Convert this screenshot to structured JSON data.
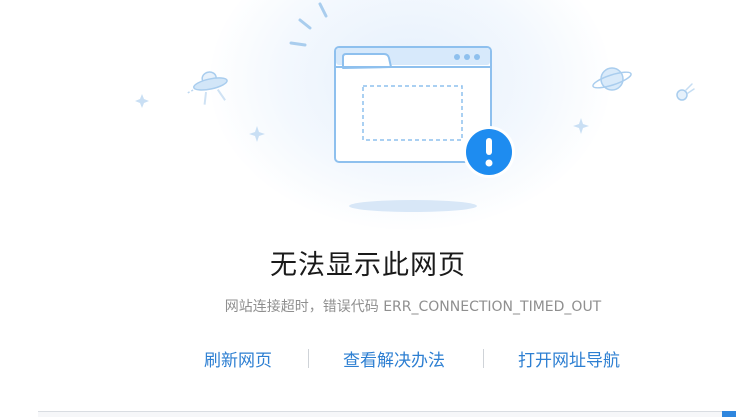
{
  "error": {
    "title": "无法显示此网页",
    "message": "网站连接超时，错误代码 ERR_CONNECTION_TIMED_OUT"
  },
  "actions": {
    "refresh": "刷新网页",
    "solutions": "查看解决办法",
    "open_nav": "打开网址导航"
  },
  "icons": {
    "illustration": "broken-browser-window-with-alert",
    "alert": "exclamation-icon",
    "ufo": "ufo-icon",
    "planet": "planet-icon",
    "comet": "comet-icon",
    "sparkle": "sparkle-icon"
  },
  "colors": {
    "accent_blue": "#1e8cf0",
    "link_blue": "#2d7fd2",
    "title": "#1a1a1a",
    "message": "#8f8f8f"
  }
}
